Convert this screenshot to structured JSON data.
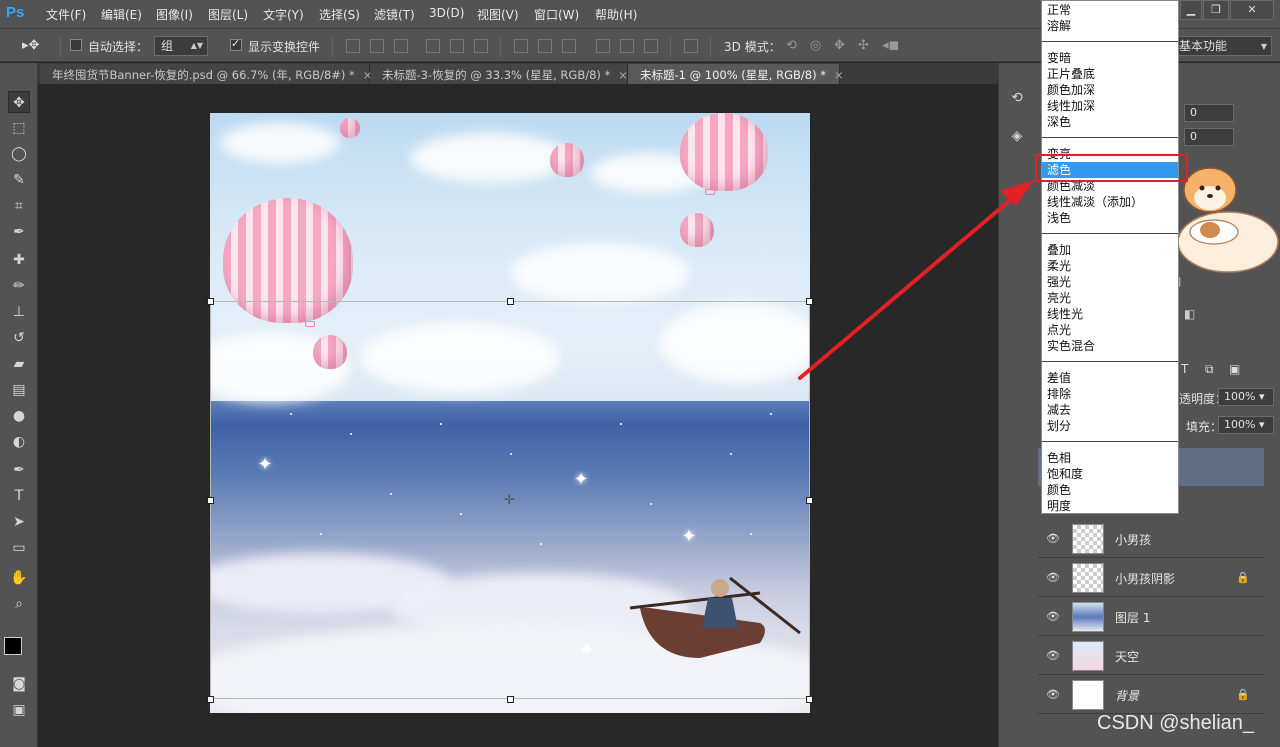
{
  "app": {
    "logo": "Ps"
  },
  "menu": [
    "文件(F)",
    "编辑(E)",
    "图像(I)",
    "图层(L)",
    "文字(Y)",
    "选择(S)",
    "滤镜(T)",
    "3D(D)",
    "视图(V)",
    "窗口(W)",
    "帮助(H)"
  ],
  "options": {
    "auto_select_label": "自动选择：",
    "auto_select_value": "组",
    "show_transform_label": "显示变换控件",
    "mode_3d_label": "3D 模式：",
    "workspace": "基本功能"
  },
  "tabs": [
    {
      "label": "年终囤货节Banner-恢复的.psd @ 66.7% (年, RGB/8#) *",
      "close": "×"
    },
    {
      "label": "未标题-3-恢复的 @ 33.3% (星星, RGB/8) *",
      "close": "×"
    },
    {
      "label": "未标题-1 @ 100% (星星, RGB/8) *",
      "close": "×"
    }
  ],
  "blend_modes": [
    [
      "正常",
      "溶解"
    ],
    [
      "变暗",
      "正片叠底",
      "颜色加深",
      "线性加深",
      "深色"
    ],
    [
      "变亮",
      "滤色",
      "颜色减淡",
      "线性减淡（添加）",
      "浅色"
    ],
    [
      "叠加",
      "柔光",
      "强光",
      "亮光",
      "线性光",
      "点光",
      "实色混合"
    ],
    [
      "差值",
      "排除",
      "减去",
      "划分"
    ],
    [
      "色相",
      "饱和度",
      "颜色",
      "明度"
    ]
  ],
  "blend_selected": "滤色",
  "properties": {
    "field1": "0",
    "field2": "0"
  },
  "layers_panel": {
    "opacity_label": "透明度：",
    "opacity_value": "100%",
    "fill_label": "填充：",
    "fill_value": "100%",
    "layers": [
      {
        "name": "小男孩",
        "locked": false
      },
      {
        "name": "小男孩阴影",
        "locked": true
      },
      {
        "name": "图层 1",
        "locked": false
      },
      {
        "name": "天空",
        "locked": false
      },
      {
        "name": "背景",
        "locked": true
      }
    ]
  },
  "watermark": "CSDN @shelian_",
  "colors": {
    "accent_red": "#e32024",
    "selection_blue": "#3399ee",
    "panel_gray": "#535353"
  }
}
